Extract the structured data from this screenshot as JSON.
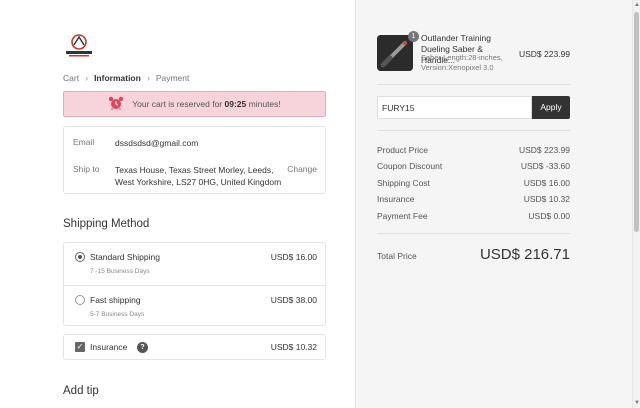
{
  "logo": {
    "text": "TACTICAL SABERS"
  },
  "breadcrumb": {
    "items": [
      "Cart",
      "Information",
      "Payment"
    ]
  },
  "timer": {
    "prefix": "Your cart is reserved for",
    "time": "09:25",
    "suffix": "minutes!"
  },
  "contact": {
    "email_label": "Email",
    "email": "dssdsdsd@gmail.com",
    "ship_label": "Ship to",
    "address": "Texas House, Texas Street Morley, Leeds, West Yorkshire, LS27 0HG, United Kingdom",
    "change": "Change"
  },
  "shipping": {
    "title": "Shipping Method",
    "options": [
      {
        "name": "Standard Shipping",
        "sub": "7 -15 Business Days",
        "price": "USD$ 16.00",
        "selected": true
      },
      {
        "name": "Fast shipping",
        "sub": "5-7 Business Days",
        "price": "USD$ 38.00",
        "selected": false
      }
    ],
    "insurance": {
      "label": "Insurance",
      "price": "USD$ 10.32",
      "checked": true
    }
  },
  "tip": {
    "title": "Add tip"
  },
  "cart": {
    "item": {
      "qty": "1",
      "title": "Outlander Training Dueling Saber & Handle...",
      "variant": "Saber Length:28-inches, Version:Xenopixel 3.0",
      "price": "USD$ 223.99"
    },
    "coupon": {
      "value": "FURY15",
      "apply": "Apply"
    },
    "summary": [
      {
        "label": "Product Price",
        "value": "USD$ 223.99"
      },
      {
        "label": "Coupon Discount",
        "value": "USD$ -33.60"
      },
      {
        "label": "Shipping Cost",
        "value": "USD$ 16.00"
      },
      {
        "label": "Insurance",
        "value": "USD$ 10.32"
      },
      {
        "label": "Payment Fee",
        "value": "USD$ 0.00"
      }
    ],
    "total": {
      "label": "Total Price",
      "value": "USD$ 216.71"
    }
  },
  "colors": {
    "timer_bg": "#f7d4dc",
    "timer_border": "#e8a9b6",
    "alarm": "#e0475e",
    "apply_bg": "#333333"
  }
}
